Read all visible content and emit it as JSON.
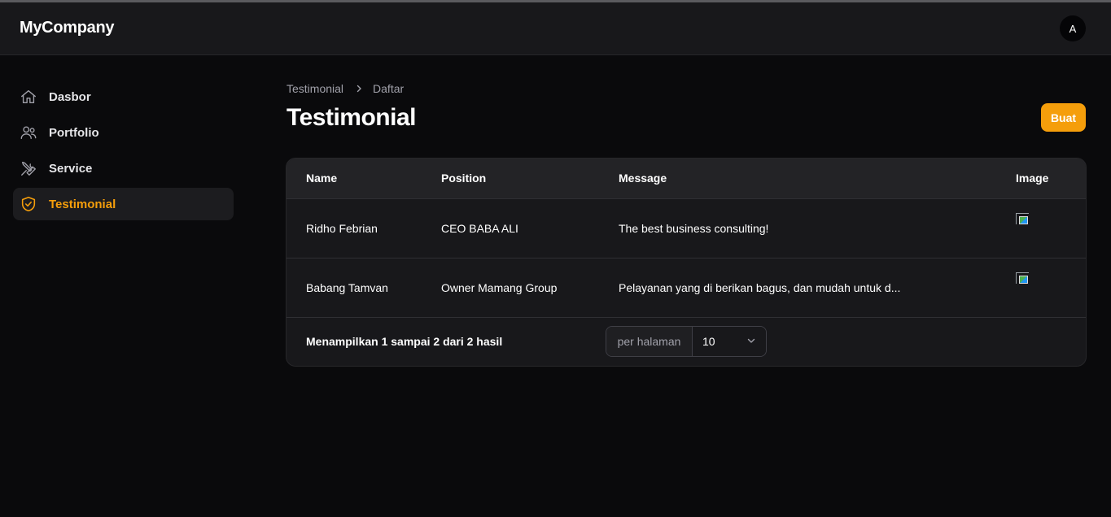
{
  "header": {
    "brand": "MyCompany",
    "avatar_initial": "A"
  },
  "sidebar": {
    "items": [
      {
        "label": "Dasbor",
        "icon": "home-icon",
        "active": false
      },
      {
        "label": "Portfolio",
        "icon": "users-icon",
        "active": false
      },
      {
        "label": "Service",
        "icon": "wrench-screwdriver-icon",
        "active": false
      },
      {
        "label": "Testimonial",
        "icon": "shield-check-icon",
        "active": true
      }
    ]
  },
  "breadcrumb": {
    "items": [
      "Testimonial",
      "Daftar"
    ]
  },
  "page": {
    "title": "Testimonial",
    "create_label": "Buat"
  },
  "table": {
    "columns": [
      "Name",
      "Position",
      "Message",
      "Image"
    ],
    "rows": [
      {
        "name": "Ridho Febrian",
        "position": "CEO BABA ALI",
        "message": "The best business consulting!"
      },
      {
        "name": "Babang Tamvan",
        "position": "Owner Mamang Group",
        "message": "Pelayanan yang di berikan bagus, dan mudah untuk d..."
      }
    ],
    "summary": "Menampilkan 1 sampai 2 dari 2 hasil",
    "per_page_label": "per halaman",
    "per_page_value": "10"
  },
  "colors": {
    "accent": "#f59e0b",
    "background": "#0a0a0c",
    "surface": "#18181b"
  }
}
